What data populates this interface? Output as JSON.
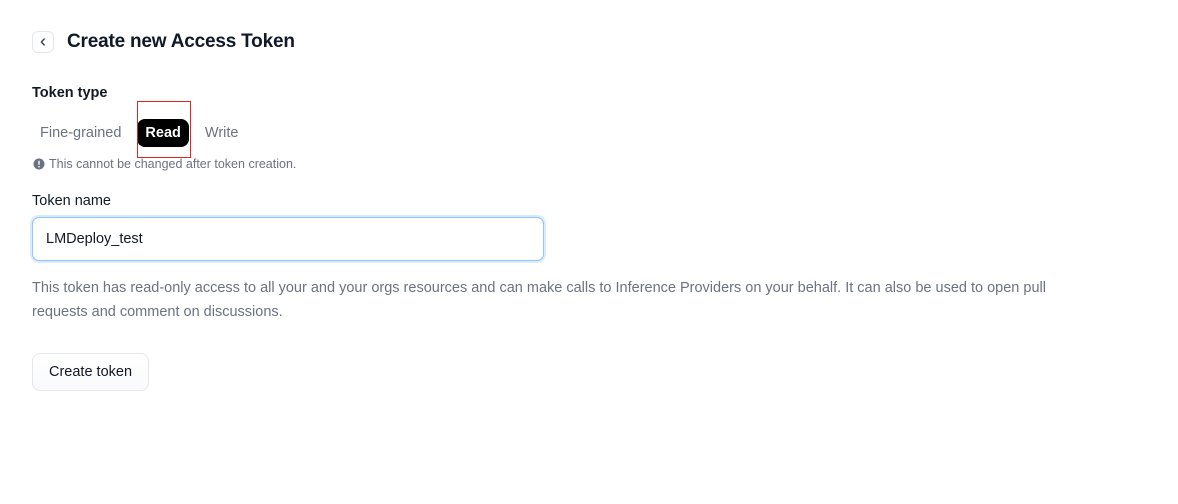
{
  "header": {
    "back_icon": "chevron-left-icon",
    "title": "Create new Access Token"
  },
  "token_type": {
    "label": "Token type",
    "tabs": [
      {
        "label": "Fine-grained",
        "active": false
      },
      {
        "label": "Read",
        "active": true
      },
      {
        "label": "Write",
        "active": false
      }
    ],
    "notice_icon": "info-circle-icon",
    "notice": "This cannot be changed after token creation."
  },
  "token_name": {
    "label": "Token name",
    "value": "LMDeploy_test"
  },
  "description": "This token has read-only access to all your and your orgs resources and can make calls to Inference Providers on your behalf. It can also be used to open pull requests and comment on discussions.",
  "actions": {
    "create_label": "Create token"
  },
  "colors": {
    "active_tab_bg": "#000000",
    "highlight_border": "#dc2626",
    "focus_border": "#93c5fd",
    "muted_text": "#6b7280"
  }
}
